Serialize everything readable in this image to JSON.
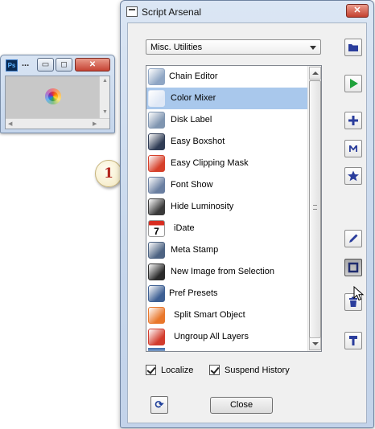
{
  "photoshop_window": {
    "logo_text": "Ps",
    "title": "...",
    "minimize": "▭",
    "maximize": "◻",
    "close": "✕"
  },
  "callout": {
    "number": "1"
  },
  "dialog": {
    "title": "Script Arsenal",
    "close": "✕",
    "category": {
      "selected": "Misc. Utilities"
    },
    "scripts": [
      {
        "label": "Chain Editor",
        "icon": "gear-icon",
        "color": "#8fa6c4",
        "selected": false
      },
      {
        "label": "Color Mixer",
        "icon": "mixer-icon",
        "color": "#dfe8f6",
        "selected": true
      },
      {
        "label": "Disk Label",
        "icon": "disk-icon",
        "color": "#7f95b0",
        "selected": false
      },
      {
        "label": "Easy Boxshot",
        "icon": "boxshot-icon",
        "color": "#2f3c55",
        "selected": false
      },
      {
        "label": "Easy Clipping Mask",
        "icon": "clipping-mask-icon",
        "color": "#d6402a",
        "selected": false
      },
      {
        "label": "Font Show",
        "icon": "font-icon",
        "color": "#6a7fa1",
        "selected": false
      },
      {
        "label": "Hide Luminosity",
        "icon": "luminosity-icon",
        "color": "#3a3a3a",
        "selected": false
      },
      {
        "label": "iDate",
        "icon": "calendar-icon",
        "color": "#d82c20",
        "selected": false
      },
      {
        "label": "Meta Stamp",
        "icon": "stamp-icon",
        "color": "#4d6382",
        "selected": false
      },
      {
        "label": "New Image from Selection",
        "icon": "selection-icon",
        "color": "#2a2a2a",
        "selected": false
      },
      {
        "label": "Pref Presets",
        "icon": "preferences-icon",
        "color": "#3d5f93",
        "selected": false
      },
      {
        "label": "Split Smart Object",
        "icon": "split-icon",
        "color": "#e9772b",
        "selected": false
      },
      {
        "label": "Ungroup All Layers",
        "icon": "ungroup-icon",
        "color": "#d23b2c",
        "selected": false
      }
    ],
    "localize": {
      "label": "Localize",
      "checked": true
    },
    "suspend_history": {
      "label": "Suspend History",
      "checked": true
    },
    "refresh_label": "⟳",
    "close_button_label": "Close",
    "toolbar": [
      {
        "name": "open-folder-button",
        "icon": "folder-icon"
      },
      {
        "name": "run-button",
        "icon": "play-icon"
      },
      {
        "name": "add-button",
        "icon": "plus-icon"
      },
      {
        "name": "macro-button",
        "icon": "letter-m-icon"
      },
      {
        "name": "favorite-button",
        "icon": "star-icon"
      },
      {
        "name": "edit-button",
        "icon": "pencil-icon"
      },
      {
        "name": "record-button",
        "icon": "square-icon"
      },
      {
        "name": "delete-button",
        "icon": "trash-icon"
      },
      {
        "name": "pin-button",
        "icon": "pin-icon"
      }
    ],
    "accent_color": "#2a3d9c",
    "play_color": "#1ea13a"
  }
}
